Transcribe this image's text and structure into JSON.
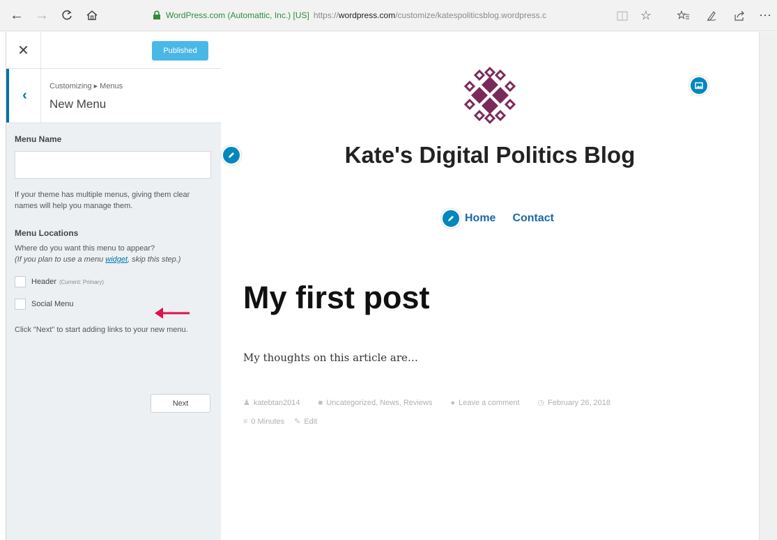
{
  "browser": {
    "cert_label": "WordPress.com (Automattic, Inc.) [US]",
    "url_scheme": "https://",
    "url_host": "wordpress.com",
    "url_path": "/customize/katespoliticsblog.wordpress.c"
  },
  "customizer": {
    "publish_label": "Published",
    "breadcrumb": "Customizing ▸ Menus",
    "section_title": "New Menu",
    "menu_name_label": "Menu Name",
    "menu_name_value": "",
    "menu_name_help": "If your theme has multiple menus, giving them clear names will help you manage them.",
    "locations_label": "Menu Locations",
    "locations_desc": "Where do you want this menu to appear?",
    "locations_help_pre": "(If you plan to use a menu ",
    "locations_help_link": "widget",
    "locations_help_post": ", skip this step.)",
    "locations": [
      {
        "label": "Header",
        "note": "(Current: Primary)",
        "checked": false
      },
      {
        "label": "Social Menu",
        "note": "",
        "checked": false
      }
    ],
    "next_help": "Click \"Next\" to start adding links to your new menu.",
    "next_label": "Next"
  },
  "preview": {
    "site_title": "Kate's Digital Politics Blog",
    "menu_items": [
      "Home",
      "Contact"
    ],
    "post_title": "My first post",
    "post_body": "My thoughts on this article are…",
    "meta": {
      "author": "katebtan2014",
      "categories": "Uncategorized, News, Reviews",
      "comments": "Leave a comment",
      "date": "February 26, 2018",
      "read_time": "0 Minutes",
      "edit": "Edit"
    }
  },
  "colors": {
    "accent": "#0087be",
    "arrow": "#e0104a",
    "logo": "#7a2a5a",
    "menu_link": "#1b6aa5"
  }
}
